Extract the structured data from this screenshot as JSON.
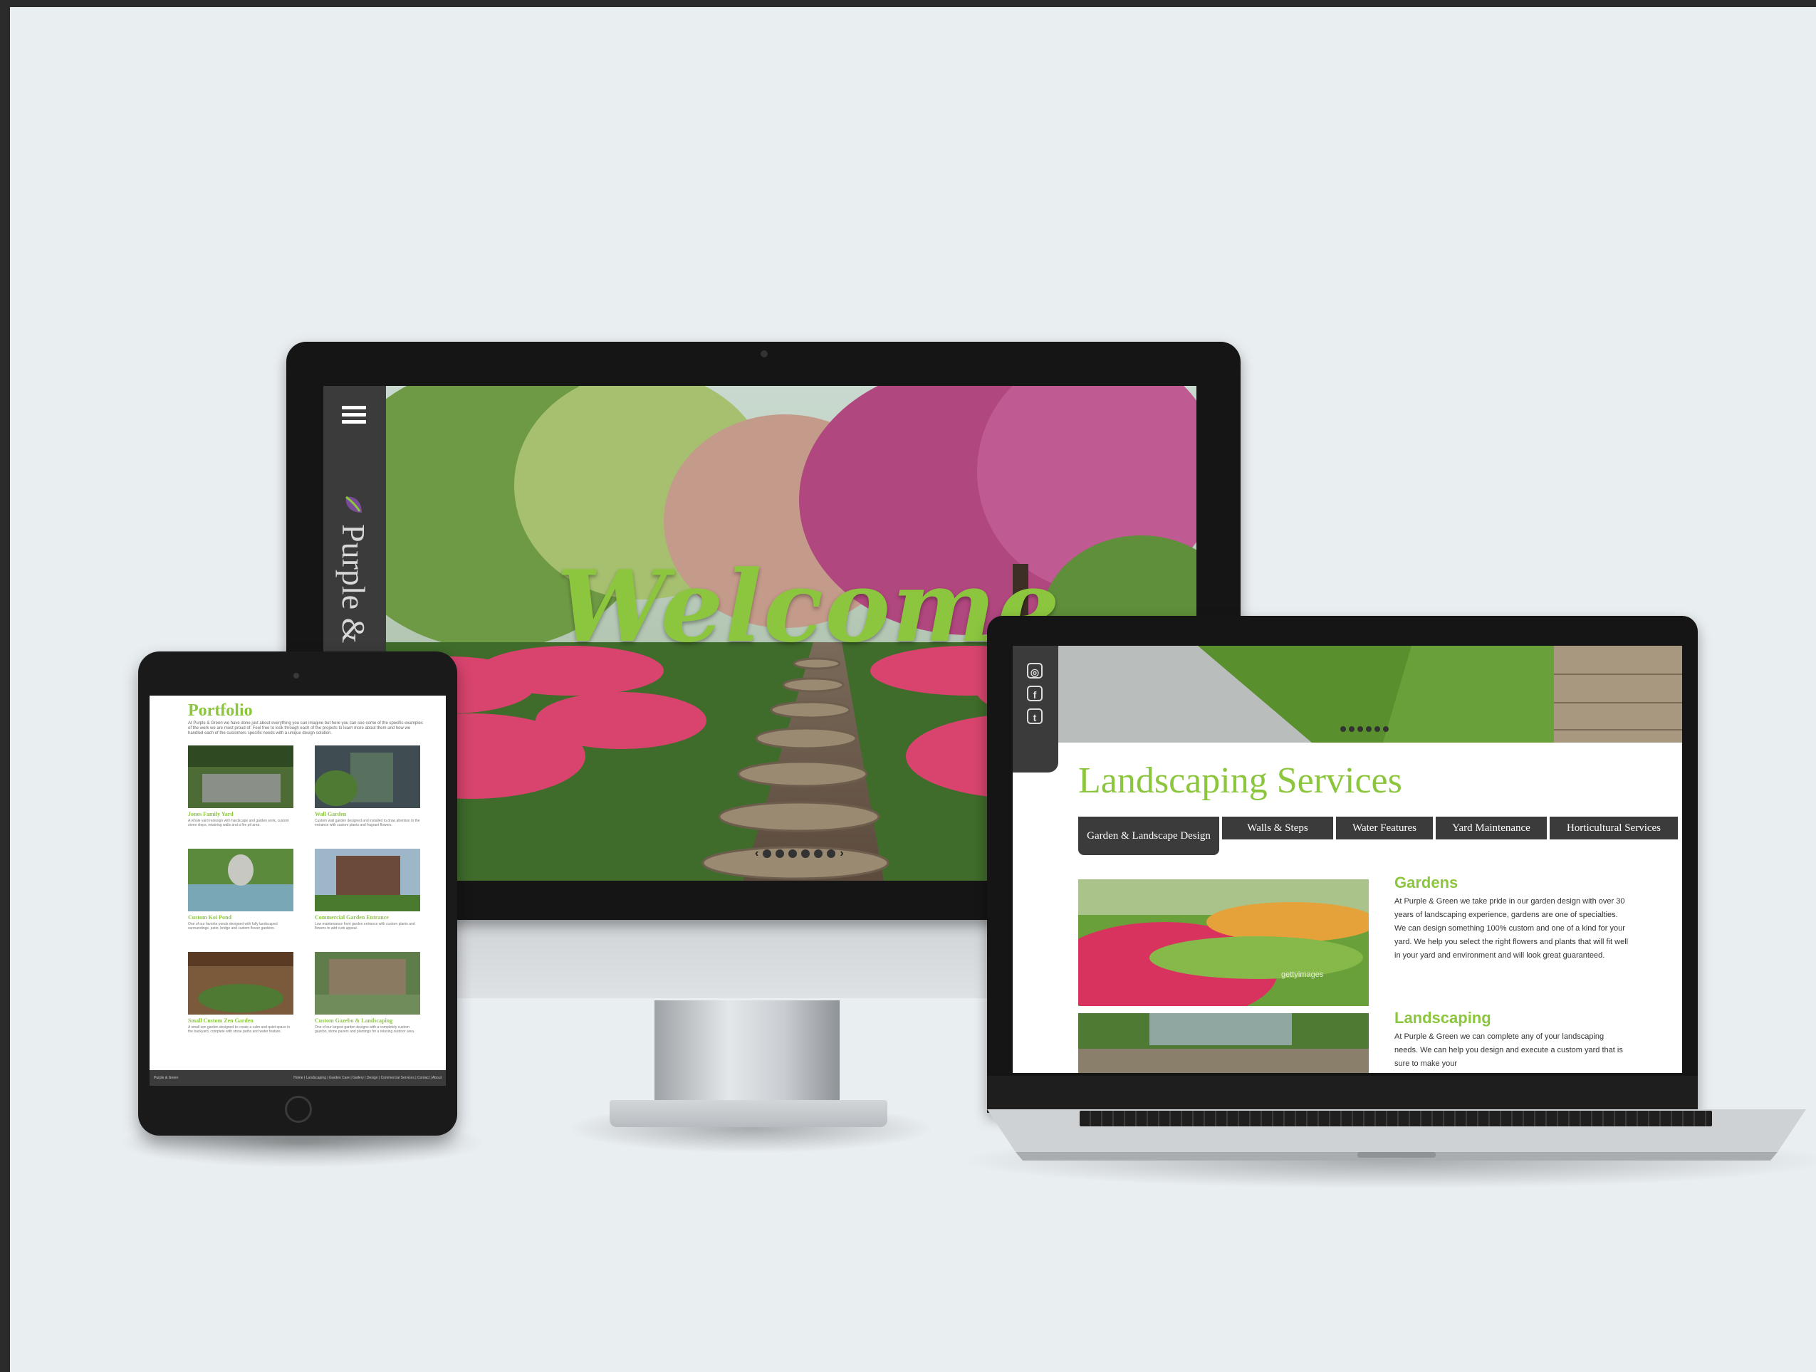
{
  "desktop": {
    "brand_name": "Purple & Green",
    "hero_heading": "Welcome",
    "slider": {
      "prev_icon": "chevron-left-icon",
      "next_icon": "chevron-right-icon",
      "dot_count": 6,
      "active_index": 0
    },
    "menu_icon": "hamburger-icon"
  },
  "tablet": {
    "title": "Portfolio",
    "intro": "At Purple & Green we have done just about everything you can imagine but here you can see some of the specific examples of the work we are most proud of. Feel free to look through each of the projects to learn more about them and how we handled each of the customers specific needs with a unique design solution.",
    "items": [
      {
        "caption": "Jones Family Yard",
        "desc": "A whole yard redesign with hardscape and garden work, custom stone steps, retaining walls and a fire pit area."
      },
      {
        "caption": "Wall Garden",
        "desc": "Custom wall garden designed and installed to draw attention to the entrance with custom plants and fragrant flowers."
      },
      {
        "caption": "Custom Koi Pond",
        "desc": "One of our favorite ponds designed with fully landscaped surroundings, patio, bridge and custom flower gardens."
      },
      {
        "caption": "Commercial Garden Entrance",
        "desc": "Low maintenance front garden entrance with custom plants and flowers to add curb appeal."
      },
      {
        "caption": "Small Custom Zen Garden",
        "desc": "A small zen garden designed to create a calm and quiet space in the backyard, complete with stone paths and water feature."
      },
      {
        "caption": "Custom Gazebo & Landscaping",
        "desc": "One of our largest garden designs with a completely custom gazebo, stone pavers and plantings for a relaxing outdoor area."
      }
    ],
    "footer_brand": "Purple & Green",
    "footer_links": "Home | Landscaping | Garden Care | Gallery | Design | Commercial Services | Contact | About"
  },
  "laptop": {
    "social_icons": [
      "instagram-icon",
      "facebook-icon",
      "twitter-icon"
    ],
    "title": "Landscaping Services",
    "tabs": [
      {
        "label": "Garden & Landscape Design",
        "active": true
      },
      {
        "label": "Walls & Steps",
        "active": false
      },
      {
        "label": "Water Features",
        "active": false
      },
      {
        "label": "Yard Maintenance",
        "active": false
      },
      {
        "label": "Horticultural Services",
        "active": false
      }
    ],
    "sections": [
      {
        "heading": "Gardens",
        "body": "At Purple & Green we take pride in our garden design with over 30 years of landscaping experience, gardens are one of specialties. We can design something 100% custom and one of a kind for your yard. We help you select the right flowers and plants that will fit well in your yard and environment and will look great guaranteed."
      },
      {
        "heading": "Landscaping",
        "body": "At Purple & Green we can complete any of your landscaping needs. We can help you design and execute a custom yard that is sure to make your"
      }
    ],
    "watermark": "gettyimages"
  },
  "colors": {
    "accent_green": "#8cc63f",
    "dark_gray": "#3b3b3b",
    "backdrop": "#e9eef1"
  }
}
